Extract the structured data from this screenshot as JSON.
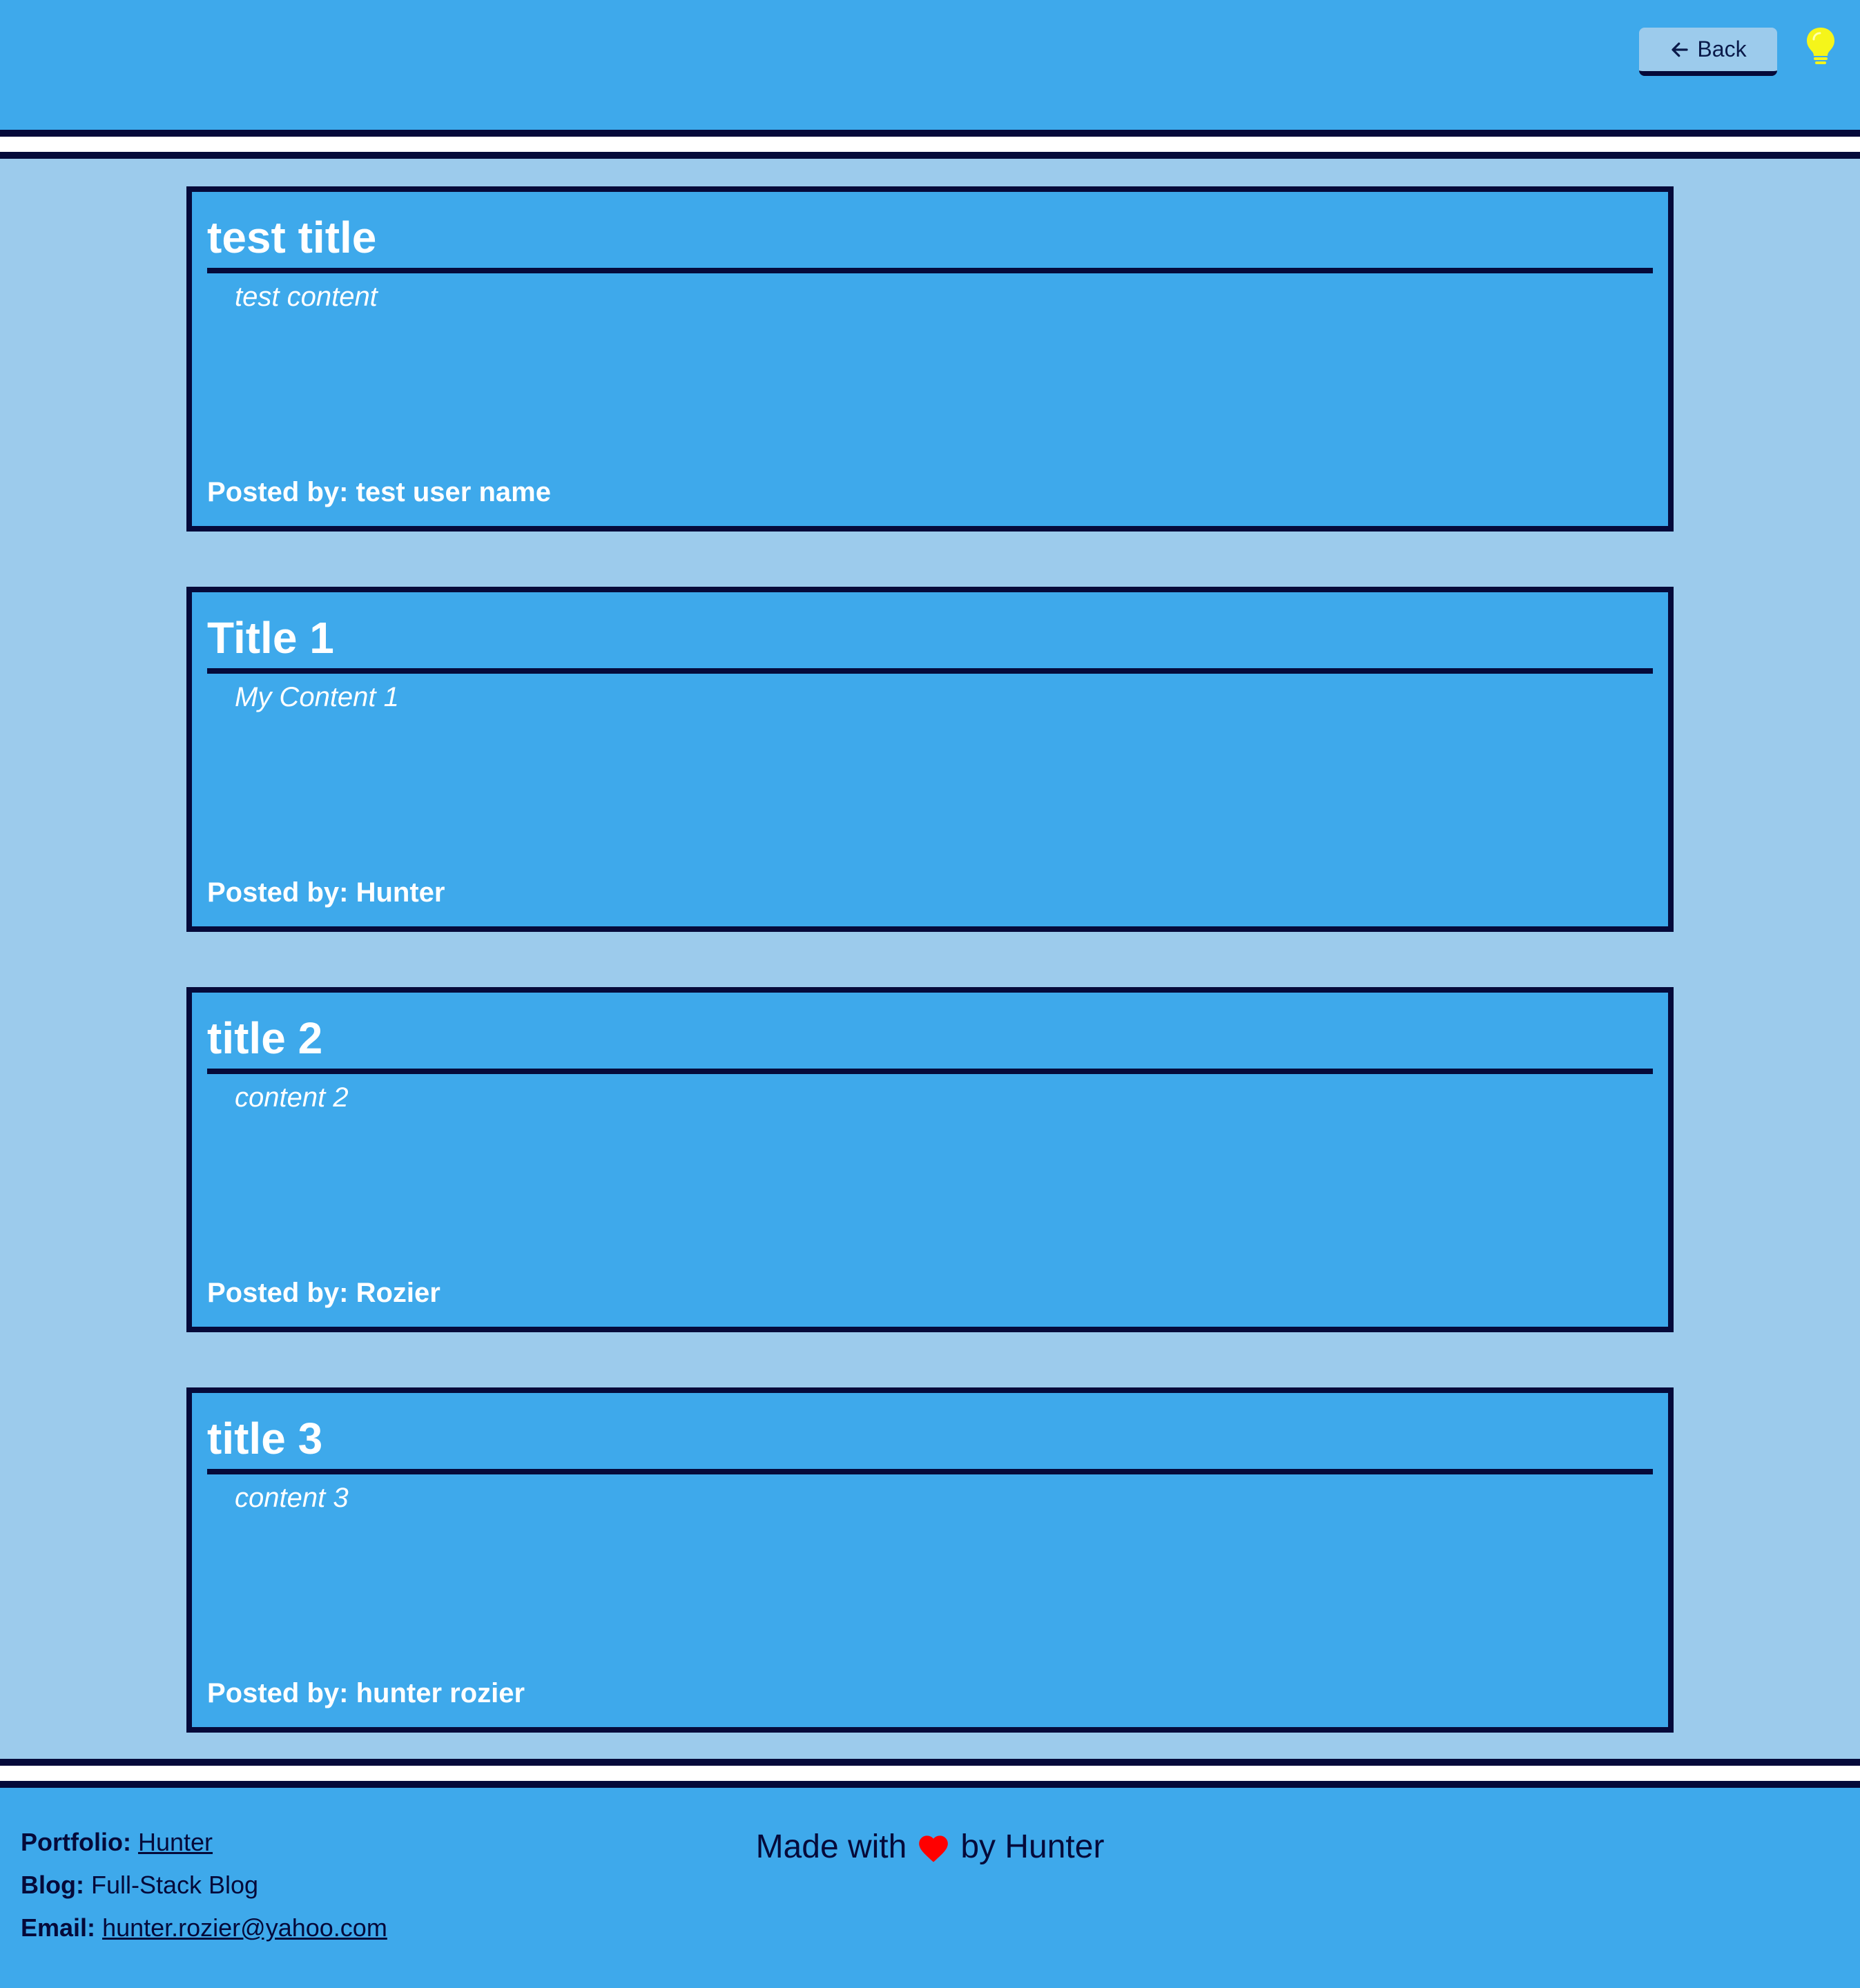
{
  "header": {
    "back_label": "Back",
    "icons": {
      "back": "arrow-left-icon",
      "theme": "lightbulb-icon"
    },
    "colors": {
      "background": "#3ea9eb",
      "bulb": "#f5f51a"
    }
  },
  "posts": [
    {
      "title": "test title",
      "content": "test content",
      "posted_by_label": "Posted by:",
      "author": "test user name"
    },
    {
      "title": "Title 1",
      "content": "My Content 1",
      "posted_by_label": "Posted by:",
      "author": "Hunter"
    },
    {
      "title": "title 2",
      "content": "content 2",
      "posted_by_label": "Posted by:",
      "author": "Rozier"
    },
    {
      "title": "title 3",
      "content": "content 3",
      "posted_by_label": "Posted by:",
      "author": "hunter rozier"
    }
  ],
  "footer": {
    "portfolio_label": "Portfolio:",
    "portfolio_link": "Hunter",
    "blog_label": "Blog:",
    "blog_value": "Full-Stack Blog",
    "email_label": "Email:",
    "email_link": "hunter.rozier@yahoo.com",
    "made_with": "Made with",
    "by_text": "by Hunter",
    "heart_icon": "heart-icon",
    "heart_color": "#ff0000"
  },
  "colors": {
    "page_bg": "#9ccbec",
    "accent": "#3ea9eb",
    "border": "#050a3a"
  }
}
